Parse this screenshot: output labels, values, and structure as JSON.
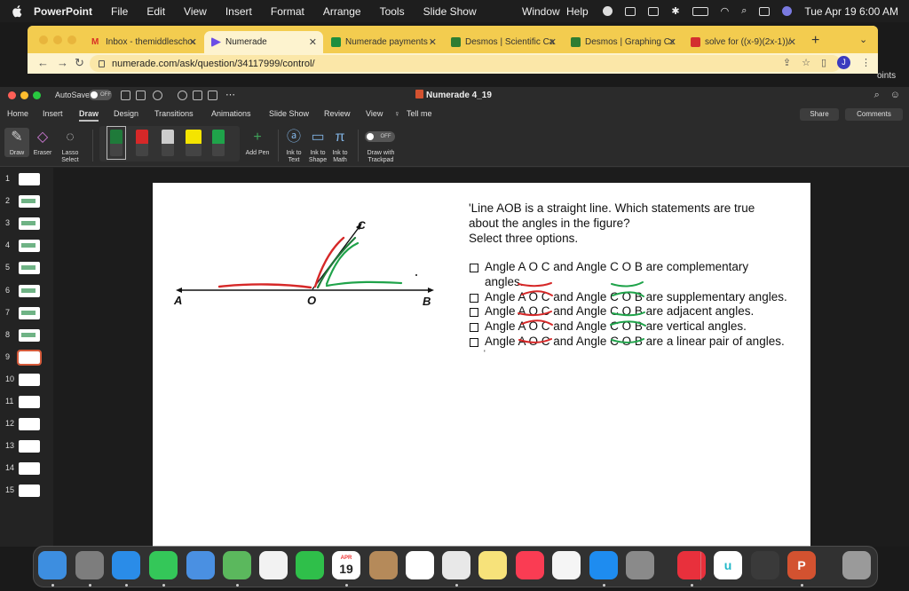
{
  "menubar": {
    "app": "PowerPoint",
    "items": [
      "File",
      "Edit",
      "View",
      "Insert",
      "Format",
      "Arrange",
      "Tools",
      "Slide Show"
    ],
    "items_right": [
      "Window",
      "Help"
    ],
    "clock": "Tue Apr 19  6:00 AM"
  },
  "browser": {
    "tabs": [
      {
        "label": "Inbox - themiddleschoo",
        "favicon_color": "#d93025"
      },
      {
        "label": "Numerade",
        "favicon_color": "#6b4ee6"
      },
      {
        "label": "Numerade payments - C",
        "favicon_color": "#1e8e3e"
      },
      {
        "label": "Desmos | Scientific Calc",
        "favicon_color": "#2e7d32"
      },
      {
        "label": "Desmos | Graphing Calc",
        "favicon_color": "#2e7d32"
      },
      {
        "label": "solve for ((x-9)(2x-1))/",
        "favicon_color": "#d32f2f"
      }
    ],
    "url": "numerade.com/ask/question/34117999/control/",
    "profile_initial": "J",
    "edge_text": "oints"
  },
  "ppt": {
    "autosave_label": "AutoSave",
    "autosave_state": "OFF",
    "doc_title": "Numerade 4_19",
    "ribbon_tabs": [
      "Home",
      "Insert",
      "Draw",
      "Design",
      "Transitions",
      "Animations",
      "Slide Show",
      "Review",
      "View",
      "Tell me"
    ],
    "active_tab": "Draw",
    "share_label": "Share",
    "comments_label": "Comments",
    "tools": {
      "draw": "Draw",
      "eraser": "Eraser",
      "lasso_1": "Lasso",
      "lasso_2": "Select",
      "add_pen": "Add Pen",
      "ink_text_1": "Ink to",
      "ink_text_2": "Text",
      "ink_shape_1": "Ink to",
      "ink_shape_2": "Shape",
      "ink_math_1": "Ink to",
      "ink_math_2": "Math",
      "trackpad_toggle": "OFF",
      "trackpad_1": "Draw with",
      "trackpad_2": "Trackpad"
    },
    "pens": [
      {
        "color": "#1f7a3a"
      },
      {
        "color": "#d62828"
      },
      {
        "color": "#cccccc"
      },
      {
        "color": "#f4e400"
      },
      {
        "color": "#1fa34a"
      }
    ],
    "slides": [
      "1",
      "2",
      "3",
      "4",
      "5",
      "6",
      "7",
      "8",
      "9",
      "10",
      "11",
      "12",
      "13",
      "14",
      "15"
    ],
    "selected_slide": "9"
  },
  "slide": {
    "question_lines": [
      "'Line AOB is a straight line. Which statements are true",
      "about the angles in the figure?",
      "Select three options."
    ],
    "options": [
      {
        "text": "Angle A O C and Angle C O B are complementary",
        "cont": "angles."
      },
      {
        "text": "Angle A O C and Angle C O B are supplementary angles."
      },
      {
        "text": "Angle A O C and Angle C O B are adjacent angles."
      },
      {
        "text": "Angle A O C and Angle C O B are vertical angles."
      },
      {
        "text": "Angle A O C and Angle C O B are a linear pair of angles."
      }
    ],
    "point_labels": {
      "a": "A",
      "o": "O",
      "b": "B",
      "c": "C"
    },
    "stray_mark": "'"
  },
  "dock": {
    "apps": [
      {
        "name": "finder",
        "color": "#3d8ee0",
        "glyph": ""
      },
      {
        "name": "launchpad",
        "color": "#7d7d7d",
        "glyph": ""
      },
      {
        "name": "safari",
        "color": "#2a8ce8",
        "glyph": ""
      },
      {
        "name": "messages",
        "color": "#34c759",
        "glyph": ""
      },
      {
        "name": "mail",
        "color": "#4a90e2",
        "glyph": ""
      },
      {
        "name": "maps",
        "color": "#5bb85d",
        "glyph": ""
      },
      {
        "name": "photos",
        "color": "#f2f2f2",
        "glyph": ""
      },
      {
        "name": "facetime",
        "color": "#2fbf4a",
        "glyph": ""
      },
      {
        "name": "calendar",
        "color": "#ffffff",
        "glyph": "19"
      },
      {
        "name": "contacts",
        "color": "#b58a5a",
        "glyph": ""
      },
      {
        "name": "reminders",
        "color": "#ffffff",
        "glyph": ""
      },
      {
        "name": "chrome",
        "color": "#e8e8e8",
        "glyph": ""
      },
      {
        "name": "notes",
        "color": "#f7e27a",
        "glyph": ""
      },
      {
        "name": "music",
        "color": "#fa3c53",
        "glyph": ""
      },
      {
        "name": "news",
        "color": "#f5f5f5",
        "glyph": ""
      },
      {
        "name": "app-store",
        "color": "#1e8cf0",
        "glyph": ""
      },
      {
        "name": "system-preferences",
        "color": "#8a8a8a",
        "glyph": ""
      },
      {
        "name": "mail-alt",
        "color": "#e8303c",
        "glyph": ""
      },
      {
        "name": "numerade",
        "color": "#ffffff",
        "glyph": "u"
      },
      {
        "name": "preview",
        "color": "#3a3a3a",
        "glyph": ""
      },
      {
        "name": "powerpoint",
        "color": "#d35230",
        "glyph": "P"
      },
      {
        "name": "trash",
        "color": "#9a9a9a",
        "glyph": ""
      }
    ],
    "calendar_month": "APR"
  }
}
